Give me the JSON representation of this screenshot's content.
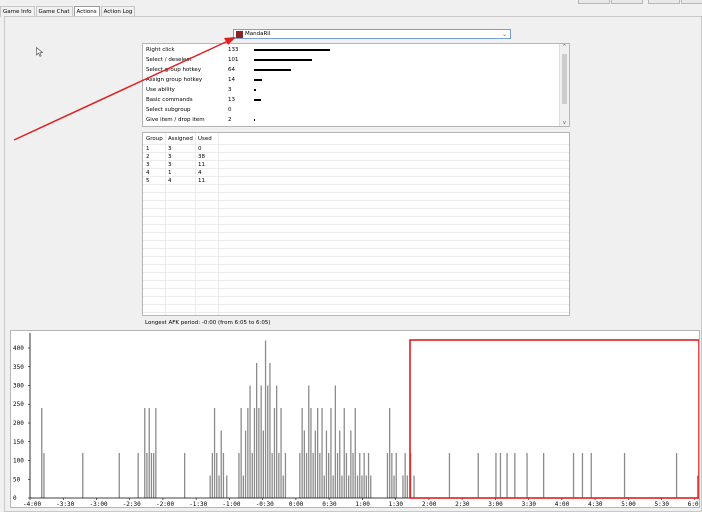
{
  "tabs": [
    {
      "label": "Game Info",
      "active": false
    },
    {
      "label": "Game Chat",
      "active": false
    },
    {
      "label": "Actions",
      "active": true
    },
    {
      "label": "Action Log",
      "active": false
    }
  ],
  "player_select": {
    "selected": "MandaRil"
  },
  "actions": [
    {
      "name": "Right click",
      "count": 133
    },
    {
      "name": "Select / deselect",
      "count": 101
    },
    {
      "name": "Select group hotkey",
      "count": 64
    },
    {
      "name": "Assign group hotkey",
      "count": 14
    },
    {
      "name": "Use ability",
      "count": 3
    },
    {
      "name": "Basic commands",
      "count": 13
    },
    {
      "name": "Select subgroup",
      "count": 0
    },
    {
      "name": "Give item / drop item",
      "count": 2
    }
  ],
  "groups": {
    "headers": [
      "Group",
      "Assigned",
      "Used"
    ],
    "rows": [
      [
        "1",
        "3",
        "0"
      ],
      [
        "2",
        "3",
        "38"
      ],
      [
        "3",
        "3",
        "11"
      ],
      [
        "4",
        "1",
        "4"
      ],
      [
        "5",
        "4",
        "11"
      ]
    ]
  },
  "afk_text": "Longest AFK period: -0:00 (from 6:05 to 6:05)",
  "colors": {
    "bars": "#8c8c8c",
    "annotation": "#e02020",
    "accent": "#7a9fd6"
  },
  "chart_data": {
    "type": "bar",
    "x_unit": "game time (min:sec)",
    "x_ticks": [
      "-4:00",
      "-3:30",
      "-3:00",
      "-2:30",
      "-2:00",
      "-1:30",
      "-1:00",
      "-0:30",
      "0:00",
      "0:30",
      "1:00",
      "1:30",
      "2:00",
      "2:30",
      "3:00",
      "3:30",
      "4:00",
      "4:30",
      "5:00",
      "5:30",
      "6:00"
    ],
    "y_ticks": [
      "0",
      "50",
      "100",
      "150",
      "200",
      "250",
      "300",
      "350",
      "400"
    ],
    "ylim": [
      0,
      440
    ],
    "xlim": [
      -240,
      362
    ],
    "grid": false,
    "series": [
      {
        "points": [
          [
            -230,
            240
          ],
          [
            -228,
            120
          ],
          [
            -193,
            120
          ],
          [
            -160,
            120
          ],
          [
            -143,
            120
          ],
          [
            -137,
            240
          ],
          [
            -135,
            120
          ],
          [
            -133,
            240
          ],
          [
            -131,
            120
          ],
          [
            -129,
            120
          ],
          [
            -127,
            240
          ],
          [
            -101,
            120
          ],
          [
            -78,
            60
          ],
          [
            -76,
            120
          ],
          [
            -74,
            240
          ],
          [
            -72,
            120
          ],
          [
            -70,
            60
          ],
          [
            -68,
            180
          ],
          [
            -66,
            120
          ],
          [
            -63,
            60
          ],
          [
            -52,
            120
          ],
          [
            -50,
            240
          ],
          [
            -48,
            60
          ],
          [
            -46,
            180
          ],
          [
            -44,
            240
          ],
          [
            -42,
            300
          ],
          [
            -40,
            120
          ],
          [
            -38,
            240
          ],
          [
            -36,
            360
          ],
          [
            -34,
            240
          ],
          [
            -32,
            300
          ],
          [
            -30,
            180
          ],
          [
            -28,
            420
          ],
          [
            -26,
            300
          ],
          [
            -24,
            360
          ],
          [
            -22,
            120
          ],
          [
            -20,
            240
          ],
          [
            -18,
            300
          ],
          [
            -16,
            120
          ],
          [
            -14,
            240
          ],
          [
            -12,
            60
          ],
          [
            -10,
            120
          ],
          [
            3,
            120
          ],
          [
            5,
            240
          ],
          [
            7,
            180
          ],
          [
            9,
            120
          ],
          [
            11,
            300
          ],
          [
            13,
            240
          ],
          [
            15,
            120
          ],
          [
            17,
            180
          ],
          [
            19,
            240
          ],
          [
            21,
            120
          ],
          [
            23,
            240
          ],
          [
            25,
            60
          ],
          [
            27,
            180
          ],
          [
            29,
            120
          ],
          [
            31,
            240
          ],
          [
            33,
            60
          ],
          [
            35,
            300
          ],
          [
            37,
            120
          ],
          [
            39,
            180
          ],
          [
            41,
            60
          ],
          [
            43,
            240
          ],
          [
            45,
            120
          ],
          [
            47,
            60
          ],
          [
            49,
            180
          ],
          [
            51,
            120
          ],
          [
            53,
            240
          ],
          [
            55,
            60
          ],
          [
            57,
            120
          ],
          [
            59,
            60
          ],
          [
            61,
            120
          ],
          [
            63,
            60
          ],
          [
            65,
            120
          ],
          [
            67,
            60
          ],
          [
            82,
            120
          ],
          [
            84,
            240
          ],
          [
            86,
            120
          ],
          [
            88,
            60
          ],
          [
            90,
            120
          ],
          [
            96,
            60
          ],
          [
            98,
            120
          ],
          [
            100,
            60
          ],
          [
            103,
            120
          ],
          [
            106,
            60
          ],
          [
            138,
            120
          ],
          [
            164,
            120
          ],
          [
            180,
            120
          ],
          [
            184,
            120
          ],
          [
            190,
            120
          ],
          [
            197,
            120
          ],
          [
            208,
            120
          ],
          [
            223,
            120
          ],
          [
            250,
            120
          ],
          [
            258,
            120
          ],
          [
            266,
            120
          ],
          [
            296,
            120
          ],
          [
            343,
            120
          ],
          [
            362,
            60
          ]
        ]
      }
    ]
  }
}
